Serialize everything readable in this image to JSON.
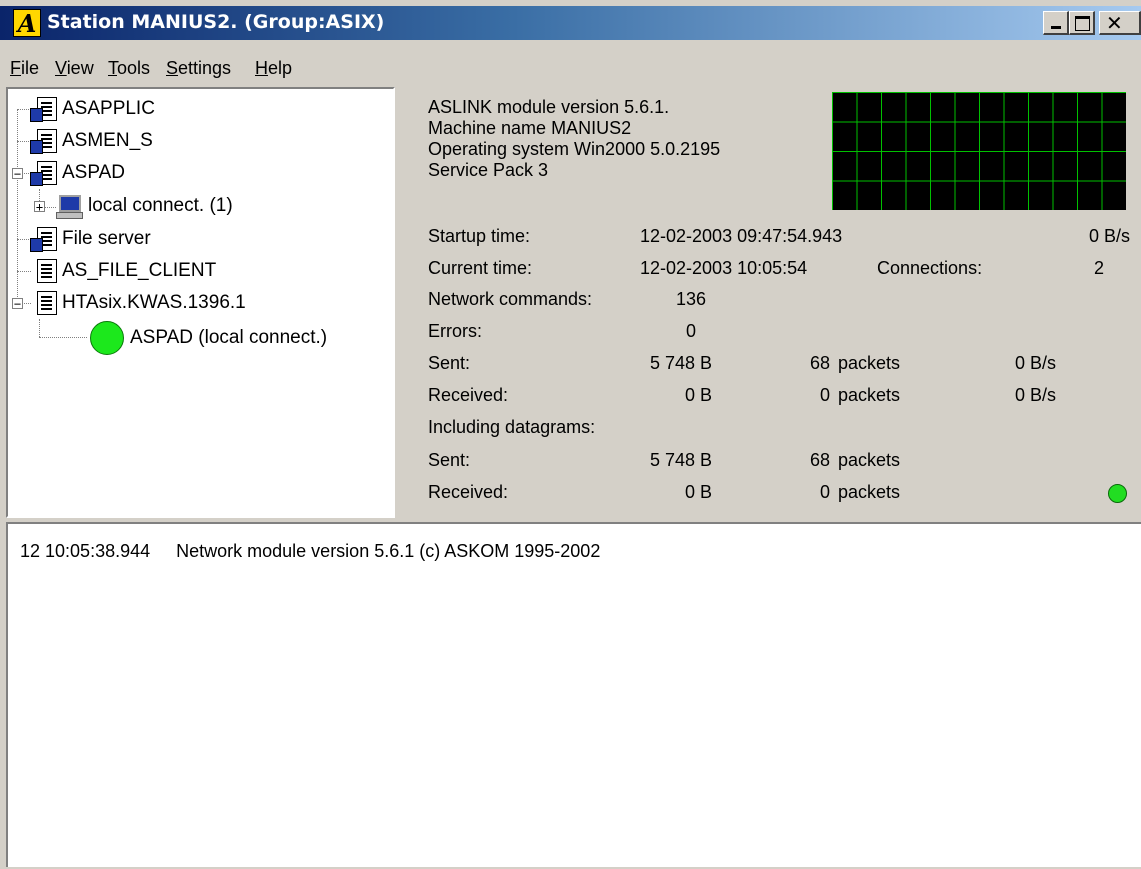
{
  "window": {
    "title": "Station MANIUS2. (Group:ASIX)",
    "app_icon": "A",
    "controls": {
      "minimize": "_",
      "maximize": "□",
      "close": "X"
    }
  },
  "menubar": [
    {
      "label": "File",
      "accel": "F"
    },
    {
      "label": "View",
      "accel": "V"
    },
    {
      "label": "Tools",
      "accel": "T"
    },
    {
      "label": "Settings",
      "accel": "S"
    },
    {
      "label": "Help",
      "accel": "H"
    }
  ],
  "tree": {
    "items": [
      {
        "label": "ASAPPLIC",
        "icon": "network-document-icon"
      },
      {
        "label": "ASMEN_S",
        "icon": "network-document-icon"
      },
      {
        "label": "ASPAD",
        "icon": "network-document-icon",
        "expanded": true
      },
      {
        "label": "local connect.  (1)",
        "icon": "computer-icon",
        "expanded": false
      },
      {
        "label": "File server",
        "icon": "network-document-icon"
      },
      {
        "label": "AS_FILE_CLIENT",
        "icon": "document-icon"
      },
      {
        "label": "HTAsix.KWAS.1396.1",
        "icon": "document-icon",
        "expanded": true
      },
      {
        "label": "ASPAD (local connect.)",
        "icon": "green-status-icon"
      }
    ]
  },
  "info": {
    "module_version": "ASLINK module version 5.6.1.",
    "machine_name": "Machine name MANIUS2",
    "os": "Operating system Win2000 5.0.2195",
    "service_pack": "Service Pack 3"
  },
  "stats": {
    "startup_label": "Startup time:",
    "startup_value": "12-02-2003 09:47:54.943",
    "startup_rate": "0 B/s",
    "current_label": "Current time:",
    "current_value": "12-02-2003 10:05:54",
    "connections_label": "Connections:",
    "connections_value": "2",
    "netcmd_label": "Network commands:",
    "netcmd_value": "136",
    "errors_label": "Errors:",
    "errors_value": "0",
    "sent_label": "Sent:",
    "sent_bytes": "5 748 B",
    "sent_packets_num": "68",
    "sent_packets_unit": "packets",
    "sent_rate": "0 B/s",
    "recv_label": "Received:",
    "recv_bytes": "0 B",
    "recv_packets_num": "0",
    "recv_packets_unit": "packets",
    "recv_rate": "0 B/s",
    "datagrams_label": "Including datagrams:",
    "dg_sent_label": "Sent:",
    "dg_sent_bytes": "5 748 B",
    "dg_sent_packets_num": "68",
    "dg_sent_packets_unit": "packets",
    "dg_recv_label": "Received:",
    "dg_recv_bytes": "0 B",
    "dg_recv_packets_num": "0",
    "dg_recv_packets_unit": "packets"
  },
  "log": {
    "lines": [
      {
        "time": "12 10:05:38.944",
        "message": "Network module version 5.6.1 (c) ASKOM 1995-2002"
      }
    ]
  },
  "colors": {
    "title_gradient_start": "#0a246a",
    "title_gradient_end": "#a6caf0",
    "scope_bg": "#000000",
    "scope_grid": "#00c000",
    "status_green": "#1ce81c"
  }
}
